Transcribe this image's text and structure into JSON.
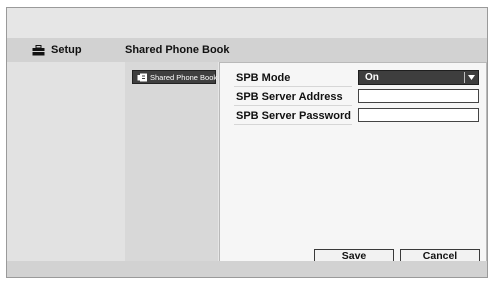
{
  "header": {
    "section_label": "Setup",
    "page_title": "Shared Phone Book"
  },
  "tabs": [
    {
      "label": "Shared Phone Book",
      "icon": "phone-book-icon",
      "selected": true
    }
  ],
  "form": {
    "mode": {
      "label": "SPB Mode",
      "value": "On"
    },
    "server_address": {
      "label": "SPB Server Address",
      "value": ""
    },
    "server_password": {
      "label": "SPB Server Password",
      "value": ""
    }
  },
  "buttons": {
    "save_label": "Save",
    "cancel_label": "Cancel"
  },
  "colors": {
    "selected_background": "#3e3e3e",
    "panel_background": "#f6f6f6",
    "chrome_background": "#d2d2d2"
  }
}
